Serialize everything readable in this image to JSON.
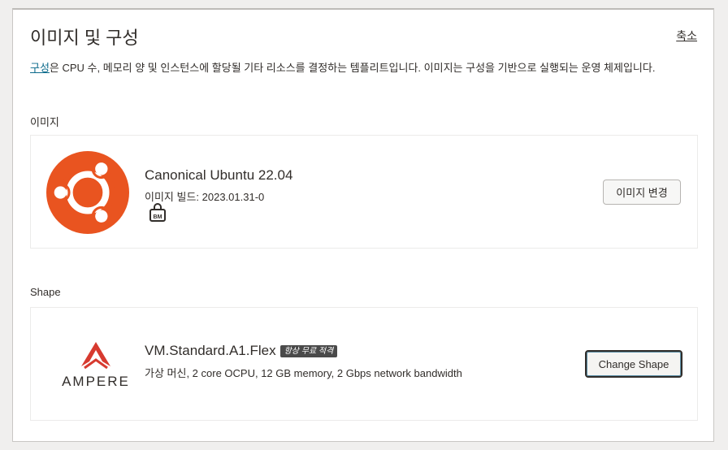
{
  "panel": {
    "title": "이미지 및 구성",
    "collapse_label": "축소",
    "description_link": "구성",
    "description_rest": "은 CPU 수, 메모리 양 및 인스턴스에 할당될 기타 리소스를 결정하는 템플리트입니다. 이미지는 구성을 기반으로 실행되는 운영 체제입니다."
  },
  "image_section": {
    "label": "이미지",
    "name": "Canonical Ubuntu 22.04",
    "build": "이미지 빌드: 2023.01.31-0",
    "bm_icon": "bare-metal-icon",
    "change_button": "이미지 변경",
    "logo": "ubuntu-logo",
    "logo_color": "#e95420"
  },
  "shape_section": {
    "label": "Shape",
    "name": "VM.Standard.A1.Flex",
    "badge": "항상 무료 적격",
    "details": "가상 머신, 2 core OCPU, 12 GB memory, 2 Gbps network bandwidth",
    "change_button": "Change Shape",
    "logo_text": "AMPERE",
    "logo_color": "#d73a2f"
  }
}
